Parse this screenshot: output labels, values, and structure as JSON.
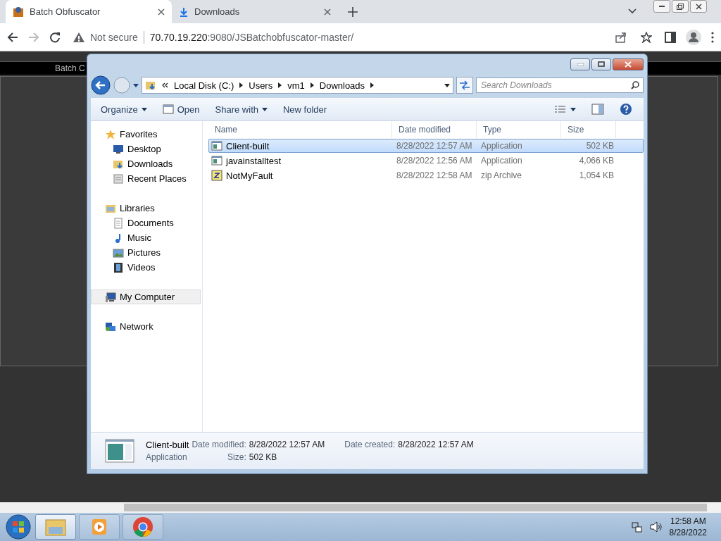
{
  "browser": {
    "tabs": [
      {
        "title": "Batch Obfuscator",
        "kind": "site",
        "selected": true
      },
      {
        "title": "Downloads",
        "kind": "download",
        "selected": false
      }
    ],
    "security": "Not secure",
    "url_host": "70.70.19.220",
    "url_rest": ":9080/JSBatchobfuscator-master/"
  },
  "page": {
    "header_text": "Batch C"
  },
  "explorer": {
    "breadcrumb": [
      "Local Disk (C:)",
      "Users",
      "vm1",
      "Downloads"
    ],
    "search": {
      "placeholder": "Search Downloads"
    },
    "toolbar": [
      {
        "label": "Organize",
        "kind": "menu"
      },
      {
        "label": "Open",
        "kind": "open"
      },
      {
        "label": "Share with",
        "kind": "menu"
      },
      {
        "label": "New folder",
        "kind": "plain"
      }
    ],
    "nav": [
      {
        "label": "Favorites",
        "kind": "star",
        "selected": false,
        "children": [
          {
            "label": "Desktop",
            "kind": "desktop",
            "selected": false
          },
          {
            "label": "Downloads",
            "kind": "downloads",
            "selected": false
          },
          {
            "label": "Recent Places",
            "kind": "recent",
            "selected": false
          }
        ]
      },
      {
        "label": "Libraries",
        "kind": "library",
        "selected": false,
        "children": [
          {
            "label": "Documents",
            "kind": "documents",
            "selected": false
          },
          {
            "label": "Music",
            "kind": "music",
            "selected": false
          },
          {
            "label": "Pictures",
            "kind": "pictures",
            "selected": false
          },
          {
            "label": "Videos",
            "kind": "videos",
            "selected": false
          }
        ]
      },
      {
        "label": "My Computer",
        "kind": "computer",
        "selected": true
      },
      {
        "label": "Network",
        "kind": "network",
        "selected": false
      }
    ],
    "columns": [
      "Name",
      "Date modified",
      "Type",
      "Size"
    ],
    "rows": [
      {
        "name": "Client-built",
        "date": "8/28/2022 12:57 AM",
        "type": "Application",
        "size": "502 KB",
        "kind": "app",
        "selected": true
      },
      {
        "name": "javainstalltest",
        "date": "8/28/2022 12:56 AM",
        "type": "Application",
        "size": "4,066 KB",
        "kind": "app",
        "selected": false
      },
      {
        "name": "NotMyFault",
        "date": "8/28/2022 12:58 AM",
        "type": "zip Archive",
        "size": "1,054 KB",
        "kind": "zip",
        "selected": false
      }
    ],
    "details": {
      "name": "Client-built",
      "type": "Application",
      "fields": [
        {
          "label": "Date modified:",
          "value": "8/28/2022 12:57 AM"
        },
        {
          "label": "Date created:",
          "value": "8/28/2022 12:57 AM"
        },
        {
          "label": "Size:",
          "value": "502 KB"
        }
      ]
    }
  },
  "taskbar": {
    "apps": [
      {
        "kind": "explorer",
        "selected": true
      },
      {
        "kind": "media",
        "selected": false
      },
      {
        "kind": "chrome",
        "selected": false
      }
    ],
    "time": "12:58 AM",
    "date": "8/28/2022"
  }
}
